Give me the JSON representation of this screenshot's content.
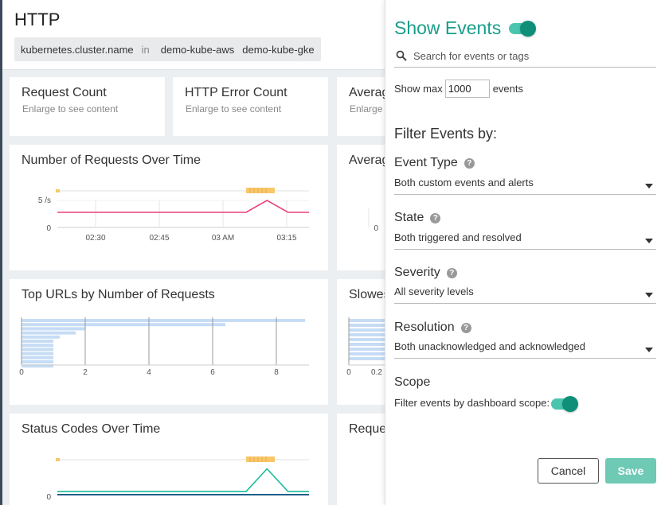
{
  "dashboard": {
    "title": "HTTP",
    "filter": {
      "key": "kubernetes.cluster.name",
      "op": "in",
      "values": [
        "demo-kube-aws",
        "demo-kube-gke"
      ]
    },
    "panels": {
      "request_count": {
        "title": "Request Count",
        "sub": "Enlarge to see content"
      },
      "http_error_count": {
        "title": "HTTP Error Count",
        "sub": "Enlarge to see content"
      },
      "average_top": {
        "title": "Averag",
        "sub": "Enlarge t"
      },
      "requests_over_time": {
        "title": "Number of Requests Over Time"
      },
      "average_mid": {
        "title": "Averag"
      },
      "top_urls": {
        "title": "Top URLs by Number of Requests"
      },
      "slowest": {
        "title": "Slowes"
      },
      "status_codes": {
        "title": "Status Codes Over Time"
      },
      "reque": {
        "title": "Reque"
      }
    }
  },
  "chart_data": [
    {
      "type": "line",
      "title": "Number of Requests Over Time",
      "x": [
        "02:30",
        "02:45",
        "03 AM",
        "03:15"
      ],
      "y_ticks": [
        "0",
        "5 /s"
      ],
      "series": [
        {
          "values": [
            2.8,
            2.8,
            2.8,
            2.8,
            2.8,
            2.8,
            2.8,
            2.8,
            2.8,
            2.8,
            5.0,
            2.8,
            2.8
          ]
        }
      ],
      "color": "#e8407a"
    },
    {
      "type": "bar",
      "title": "Top URLs by Number of Requests",
      "orientation": "horizontal",
      "values": [
        8.9,
        6.4,
        2.0,
        1.7,
        1.2,
        1.0,
        1.0,
        1.0,
        1.0,
        1.0,
        1.0,
        1.0
      ],
      "x_ticks": [
        "0",
        "2",
        "4",
        "6",
        "8"
      ],
      "xlim": [
        0,
        9
      ],
      "color": "#c6dcf5"
    },
    {
      "type": "line",
      "title": "Status Codes Over Time",
      "y_ticks": [
        "0"
      ],
      "series": [
        {
          "values": [
            0.3,
            0.3,
            0.3,
            0.3,
            0.3,
            0.3,
            0.3,
            0.3,
            0.3,
            0.3,
            2.5,
            0.3,
            0.3
          ]
        }
      ],
      "color": "#1abc9c"
    },
    {
      "type": "bar",
      "title": "Slowes",
      "orientation": "horizontal",
      "x_ticks": [
        "0",
        "0.2"
      ],
      "color": "#c6dcf5"
    }
  ],
  "axis": {
    "req_y_top": "5 /s",
    "req_y_zero": "0",
    "req_x": [
      "02:30",
      "02:45",
      "03 AM",
      "03:15"
    ],
    "avg_y_zero": "0",
    "top_x": [
      "0",
      "2",
      "4",
      "6",
      "8"
    ],
    "slow_x": [
      "0",
      "0.2"
    ],
    "status_y_zero": "0"
  },
  "side": {
    "title": "Show Events",
    "search_placeholder": "Search for events or tags",
    "show_max_label": "Show max",
    "show_max_value": "1000",
    "events_label": "events",
    "filter_title": "Filter Events by:",
    "event_type_label": "Event Type",
    "event_type_value": "Both custom events and alerts",
    "state_label": "State",
    "state_value": "Both triggered and resolved",
    "severity_label": "Severity",
    "severity_value": "All severity levels",
    "resolution_label": "Resolution",
    "resolution_value": "Both unacknowledged and acknowledged",
    "scope_label": "Scope",
    "scope_text": "Filter events by dashboard scope:",
    "cancel_label": "Cancel",
    "save_label": "Save",
    "help_glyph": "?"
  },
  "colors": {
    "accent": "#1a9e8a",
    "pink_line": "#e8407a",
    "teal_line": "#1abc9c",
    "event_marker": "#f7c86a",
    "bar": "#c6dcf5"
  }
}
